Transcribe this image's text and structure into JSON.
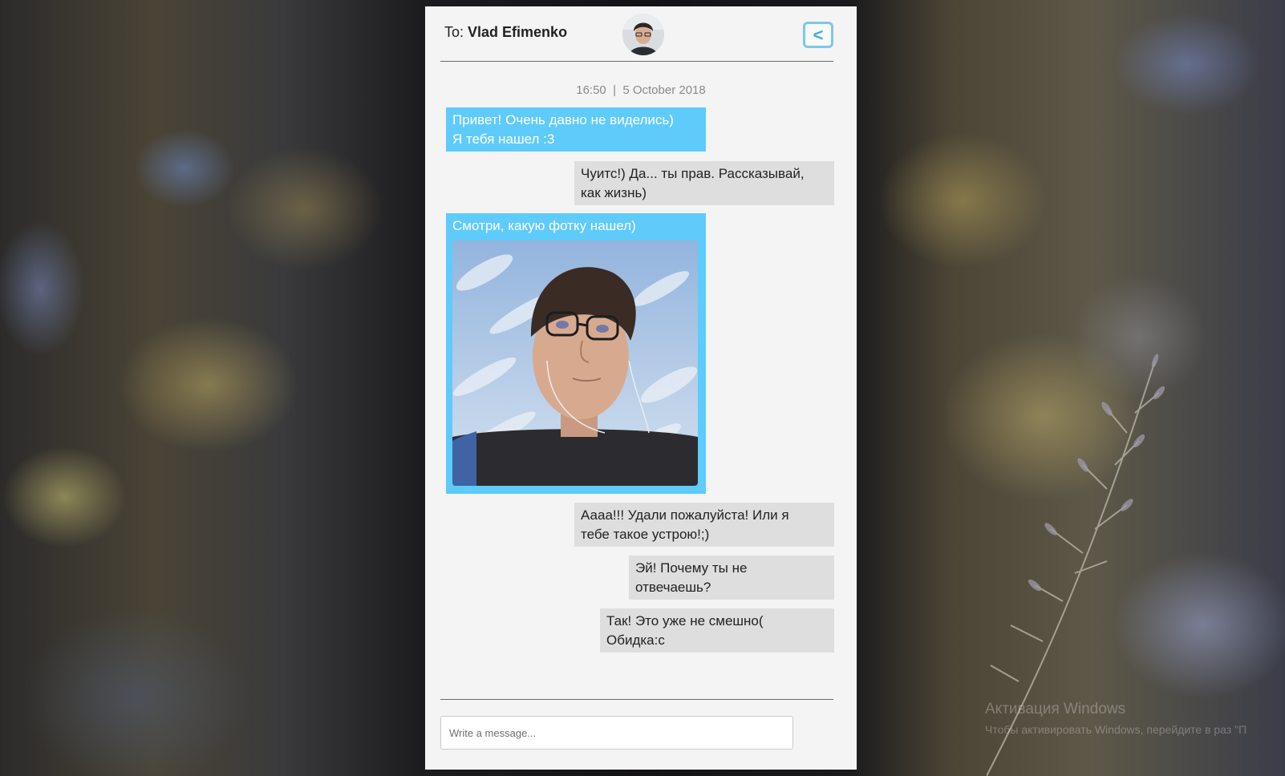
{
  "header": {
    "to_label": "To:",
    "recipient_name": "Vlad Efimenko",
    "back_label": "<"
  },
  "timestamp": "16:50  |  5 October 2018",
  "messages": [
    {
      "side": "out",
      "line1": "Привет! Очень давно не виделись)",
      "line2": "Я тебя нашел :3"
    },
    {
      "side": "in",
      "line1": "Чуитс!) Да... ты прав. Рассказывай,",
      "line2": "как жизнь)"
    },
    {
      "side": "out",
      "line1": "Смотри, какую фотку нашел)",
      "has_photo": true
    },
    {
      "side": "in",
      "line1": "Аааа!!! Удали пожалуйста! Или я",
      "line2": "тебе такое устрою!;)"
    },
    {
      "side": "in",
      "line1": "Эй! Почему ты не",
      "line2": "отвечаешь?"
    },
    {
      "side": "in",
      "line1": "Так! Это уже не смешно(",
      "line2": "Обидка:с"
    }
  ],
  "composer": {
    "placeholder": "Write a message..."
  },
  "watermark": {
    "title": "Активация Windows",
    "text": "Чтобы активировать Windows, перейдите в раз    \"П"
  },
  "colors": {
    "accent_out": "#5ecbfb",
    "bubble_in": "#dedede",
    "panel": "#f4f4f4",
    "back_button_border": "#7fc7e8"
  },
  "icons": [
    "avatar-photo",
    "back-arrow-icon"
  ]
}
